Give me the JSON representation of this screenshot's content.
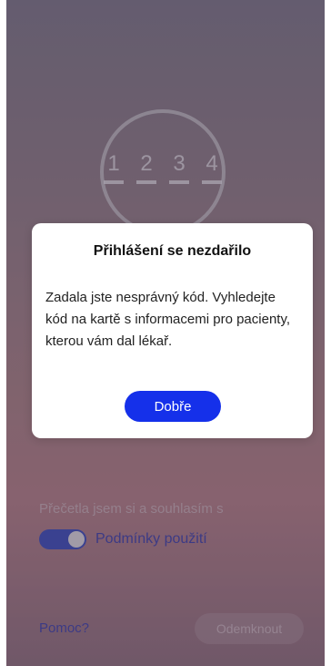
{
  "code_indicator": {
    "digits": [
      "1",
      "2",
      "3",
      "4"
    ]
  },
  "consent": {
    "text": "Přečetla jsem si a souhlasím s",
    "terms_link": "Podmínky použití",
    "toggle_on": true
  },
  "footer": {
    "help_link": "Pomoc?",
    "unlock_button": "Odemknout"
  },
  "dialog": {
    "title": "Přihlášení se nezdařilo",
    "message": "Zadala jste nesprávný kód. Vyhledejte kód na kartě s informacemi pro pacienty, kterou vám dal lékař.",
    "ok_button": "Dobře"
  },
  "colors": {
    "accent": "#1530ea",
    "link": "#3d3da8",
    "toggle_track": "#3a48b8"
  },
  "icons": {
    "toggle": "toggle-switch-on"
  }
}
